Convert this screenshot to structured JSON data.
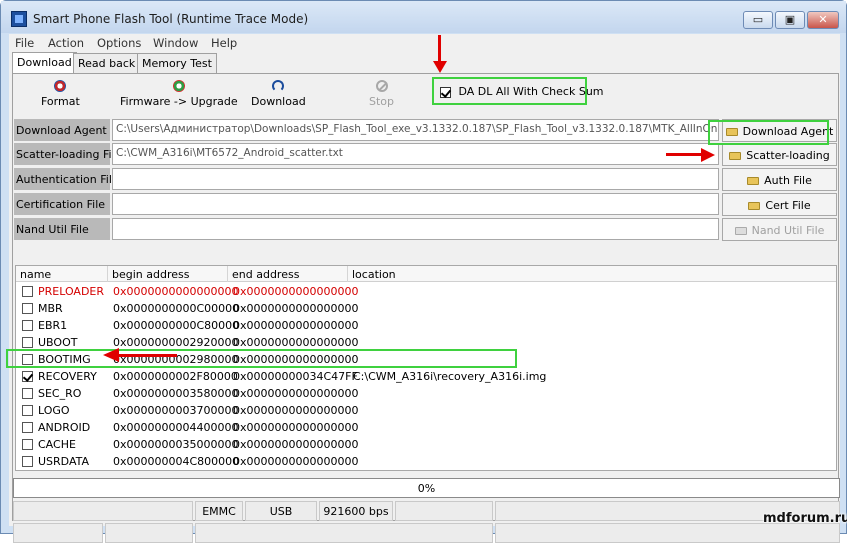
{
  "window": {
    "title": "Smart Phone Flash Tool (Runtime Trace Mode)",
    "min": "▭",
    "max": "▣",
    "close": "✕"
  },
  "menu": [
    "File",
    "Action",
    "Options",
    "Window",
    "Help"
  ],
  "tabs": [
    "Download",
    "Read back",
    "Memory Test"
  ],
  "toolbar": {
    "format": "Format",
    "firmware": "Firmware -> Upgrade",
    "download": "Download",
    "stop": "Stop"
  },
  "checksum": {
    "label": "DA DL All With Check Sum",
    "checked": true
  },
  "fields": {
    "download_agent": {
      "label": "Download Agent",
      "value": "C:\\Users\\Администратор\\Downloads\\SP_Flash_Tool_exe_v3.1332.0.187\\SP_Flash_Tool_v3.1332.0.187\\MTK_AllInOne_DA"
    },
    "scatter": {
      "label": "Scatter-loading File",
      "value": "C:\\CWM_A316i\\MT6572_Android_scatter.txt"
    },
    "auth": {
      "label": "Authentication File",
      "value": ""
    },
    "cert": {
      "label": "Certification File",
      "value": ""
    },
    "nand": {
      "label": "Nand Util File",
      "value": ""
    }
  },
  "side_buttons": {
    "download_agent": "Download Agent",
    "scatter": "Scatter-loading",
    "auth": "Auth File",
    "cert": "Cert File",
    "nand": "Nand Util File"
  },
  "list": {
    "headers": [
      "name",
      "begin address",
      "end address",
      "location"
    ],
    "rows": [
      {
        "checked": false,
        "name": "PRELOADER",
        "begin": "0x0000000000000000",
        "end": "0x0000000000000000",
        "location": "",
        "red": true
      },
      {
        "checked": false,
        "name": "MBR",
        "begin": "0x0000000000C00000",
        "end": "0x0000000000000000",
        "location": ""
      },
      {
        "checked": false,
        "name": "EBR1",
        "begin": "0x0000000000C80000",
        "end": "0x0000000000000000",
        "location": ""
      },
      {
        "checked": false,
        "name": "UBOOT",
        "begin": "0x0000000002920000",
        "end": "0x0000000000000000",
        "location": ""
      },
      {
        "checked": false,
        "name": "BOOTIMG",
        "begin": "0x0000000002980000",
        "end": "0x0000000000000000",
        "location": ""
      },
      {
        "checked": true,
        "name": "RECOVERY",
        "begin": "0x0000000002F80000",
        "end": "0x00000000034C47FF",
        "location": "C:\\CWM_A316i\\recovery_A316i.img"
      },
      {
        "checked": false,
        "name": "SEC_RO",
        "begin": "0x0000000003580000",
        "end": "0x0000000000000000",
        "location": ""
      },
      {
        "checked": false,
        "name": "LOGO",
        "begin": "0x0000000003700000",
        "end": "0x0000000000000000",
        "location": ""
      },
      {
        "checked": false,
        "name": "ANDROID",
        "begin": "0x0000000004400000",
        "end": "0x0000000000000000",
        "location": ""
      },
      {
        "checked": false,
        "name": "CACHE",
        "begin": "0x0000000035000000",
        "end": "0x0000000000000000",
        "location": ""
      },
      {
        "checked": false,
        "name": "USRDATA",
        "begin": "0x000000004C800000",
        "end": "0x0000000000000000",
        "location": ""
      }
    ]
  },
  "progress": {
    "label": "0%",
    "value": 0
  },
  "status": {
    "storage": "EMMC",
    "port": "USB",
    "baud": "921600 bps"
  },
  "watermark": "mdforum.ru",
  "colors": {
    "highlight": "#3fd13f",
    "arrow": "#e00000",
    "red_row": "#d40000"
  }
}
